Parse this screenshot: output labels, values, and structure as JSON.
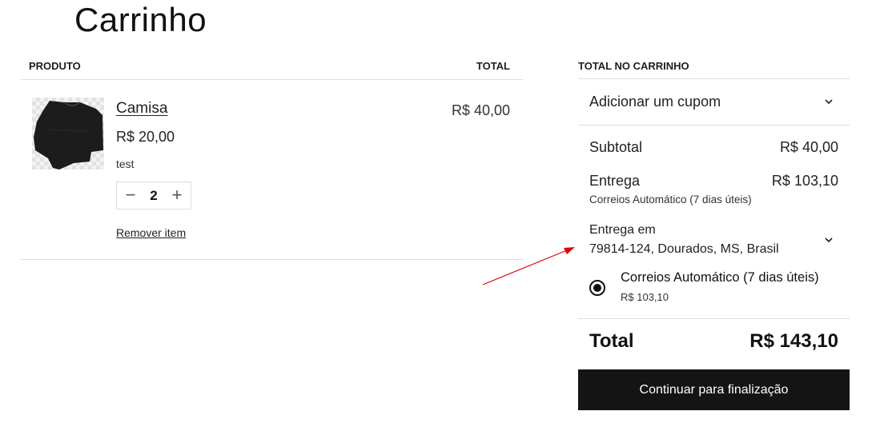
{
  "page": {
    "title": "Carrinho"
  },
  "cart": {
    "headers": {
      "product": "PRODUTO",
      "total": "TOTAL"
    },
    "items": [
      {
        "name": "Camisa",
        "unit_price": "R$ 20,00",
        "meta": "test",
        "quantity": "2",
        "line_total": "R$ 40,00",
        "remove_label": "Remover item",
        "image_icon": "tshirt-icon"
      }
    ],
    "qty_minus": "−",
    "qty_plus": "+"
  },
  "totals": {
    "heading": "TOTAL NO CARRINHO",
    "coupon_label": "Adicionar um cupom",
    "subtotal_label": "Subtotal",
    "subtotal_value": "R$ 40,00",
    "shipping_label": "Entrega",
    "shipping_value": "R$ 103,10",
    "shipping_method": "Correios Automático (7 dias úteis)",
    "ship_to_label": "Entrega em",
    "ship_to_address": "79814-124, Dourados, MS, Brasil",
    "shipping_options": [
      {
        "label": "Correios Automático (7 dias úteis)",
        "price": "R$ 103,10",
        "selected": true
      }
    ],
    "total_label": "Total",
    "total_value": "R$ 143,10",
    "checkout_label": "Continuar para finalização"
  },
  "colors": {
    "button_bg": "#141414",
    "border": "#dddddd",
    "annotation_arrow": "#e00000"
  }
}
